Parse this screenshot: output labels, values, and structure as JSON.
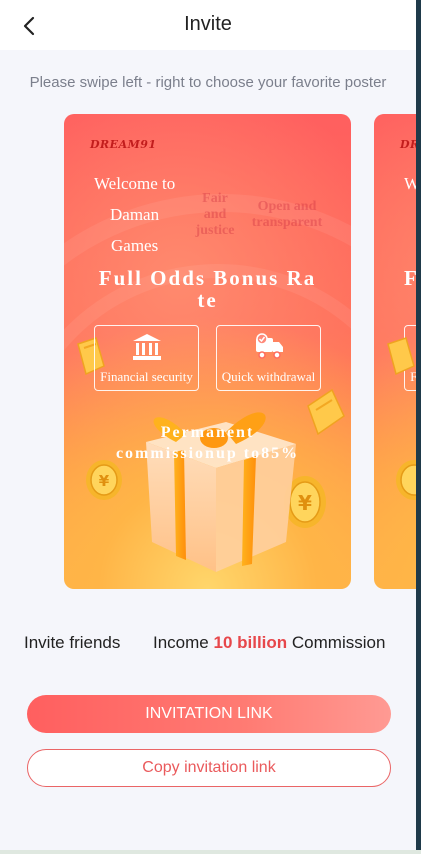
{
  "header": {
    "title": "Invite",
    "back_icon": "chevron-left-icon"
  },
  "hint": "Please swipe left - right to choose your favorite poster",
  "poster": {
    "brand": "DREAM91",
    "welcome_lines": [
      "Welcome to",
      "Daman",
      "Games"
    ],
    "fair_lines": [
      "Fair",
      "and",
      "justice"
    ],
    "open_lines": [
      "Open and",
      "transparent"
    ],
    "headline_line1": "Full Odds Bonus Ra",
    "headline_line2": "te",
    "features": [
      {
        "label": "Financial security",
        "icon": "bank-icon"
      },
      {
        "label": "Quick withdrawal",
        "icon": "truck-icon"
      }
    ],
    "commission_line1": "Permanent",
    "commission_line2": "commissionup to85%"
  },
  "stats": {
    "invite_label": "Invite friends",
    "income_label": "Income",
    "income_amount": "10 billion",
    "commission_label": "Commission"
  },
  "buttons": {
    "invitation_link": "INVITATION LINK",
    "copy_link": "Copy invitation link"
  },
  "colors": {
    "accent": "#e7474b",
    "poster_top": "#ff5f5f",
    "poster_bottom": "#ffb148",
    "button_gradient_end": "#ff9a93"
  }
}
